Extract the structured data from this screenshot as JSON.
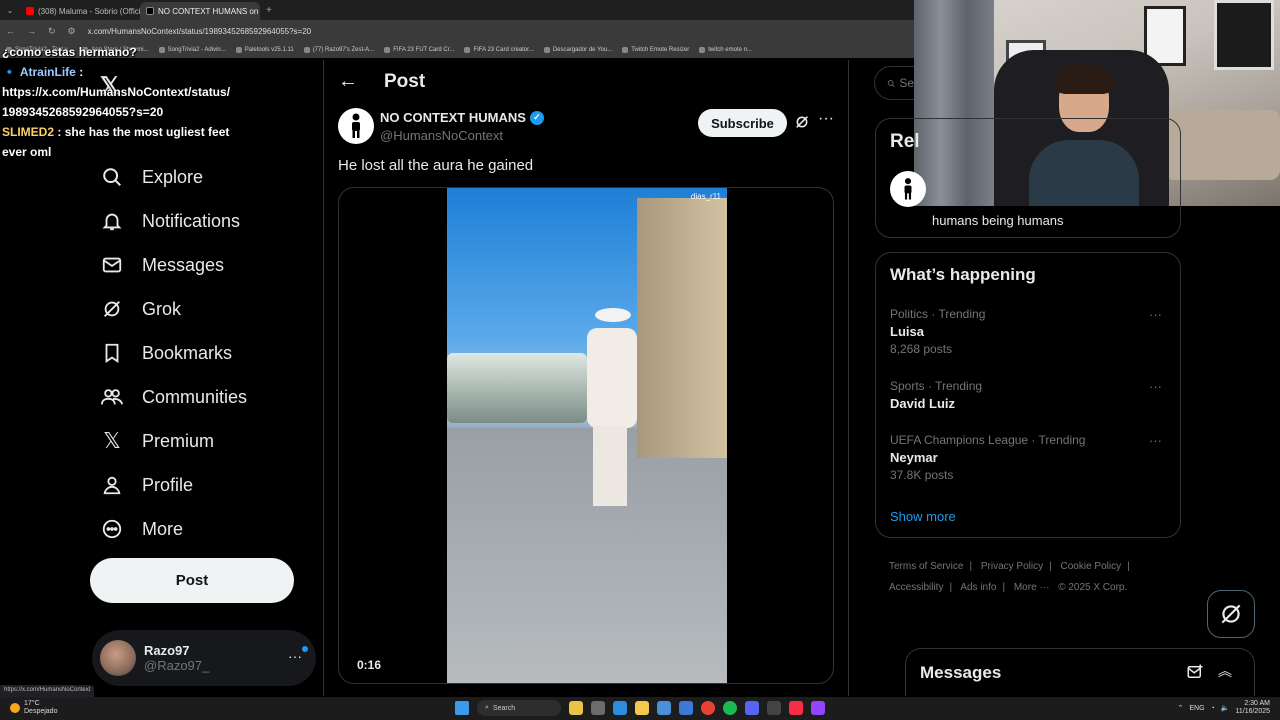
{
  "browser": {
    "tabs": [
      {
        "title": "(308) Maluma - Sobrio (Officia...",
        "active": false
      },
      {
        "title": "NO CONTEXT HUMANS on X: ...",
        "active": true
      }
    ],
    "url": "x.com/HumansNoContext/status/1989345268592964055?s=20",
    "bookmarks": [
      "SongTrivia2 - Test y...",
      "App Store / Streami...",
      "SongTrivia2 - Adivin...",
      "Paletools v25.1.11",
      "(77) Razo97's Zest-A...",
      "FIFA 23 FUT Card Cr...",
      "FIFA 23 Card creator...",
      "Descargador de You...",
      "Twitch Emote Resizer",
      "twitch emote n..."
    ],
    "status_url": "https://x.com/HumansNoContext"
  },
  "chat": {
    "line0": "¿como estas hermano?",
    "user1": "AtrainLife",
    "msg1": "https://x.com/HumansNoContext/status/1989345268592964055?s=20",
    "user2": "SLIMED2",
    "msg2": "she has the most ugliest feet ever oml"
  },
  "sidebar": {
    "items": [
      {
        "label": "Explore",
        "icon": "search-icon"
      },
      {
        "label": "Notifications",
        "icon": "bell-icon"
      },
      {
        "label": "Messages",
        "icon": "envelope-icon"
      },
      {
        "label": "Grok",
        "icon": "grok-icon"
      },
      {
        "label": "Bookmarks",
        "icon": "bookmark-icon"
      },
      {
        "label": "Communities",
        "icon": "people-icon"
      },
      {
        "label": "Premium",
        "icon": "x-icon"
      },
      {
        "label": "Profile",
        "icon": "person-icon"
      },
      {
        "label": "More",
        "icon": "more-circle-icon"
      }
    ],
    "post_label": "Post",
    "account": {
      "name": "Razo97",
      "handle": "@Razo97_"
    }
  },
  "main": {
    "header_title": "Post",
    "author_name": "NO CONTEXT HUMANS",
    "author_handle": "@HumansNoContext",
    "subscribe_label": "Subscribe",
    "text": "He lost all the aura he gained",
    "video_tag": "dias_r11",
    "video_time": "0:16"
  },
  "right": {
    "search_placeholder": "Se",
    "relevant_title": "Rel",
    "relevant_bio": "humans being humans",
    "happening_title": "What’s happening",
    "trends": [
      {
        "category": "Politics · Trending",
        "name": "Luisa",
        "count": "8,268 posts"
      },
      {
        "category": "Sports · Trending",
        "name": "David Luiz",
        "count": ""
      },
      {
        "category": "UEFA Champions League · Trending",
        "name": "Neymar",
        "count": "37.8K posts"
      }
    ],
    "show_more": "Show more",
    "footer": {
      "terms": "Terms of Service",
      "privacy": "Privacy Policy",
      "cookie": "Cookie Policy",
      "accessibility": "Accessibility",
      "ads": "Ads info",
      "more": "More ···",
      "copyright": "© 2025 X Corp."
    },
    "messages_title": "Messages"
  },
  "taskbar": {
    "weather_temp": "17°C",
    "weather_desc": "Despejado",
    "search_label": "Search",
    "lang": "ENG",
    "time": "2:30 AM",
    "date": "11/16/2025"
  },
  "colors": {
    "accent": "#1d9bf0",
    "bg": "#000000",
    "border": "#2f3336",
    "muted": "#71767b"
  }
}
